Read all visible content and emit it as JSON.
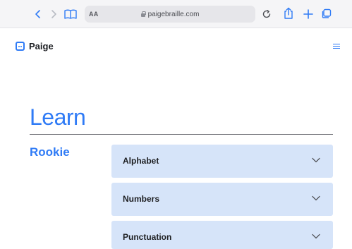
{
  "browser": {
    "text_size_label": "AA",
    "url": "paigebraille.com"
  },
  "site": {
    "logo_text": "Paige"
  },
  "main": {
    "title": "Learn",
    "level_heading": "Rookie",
    "sections": [
      {
        "label": "Alphabet"
      },
      {
        "label": "Numbers"
      },
      {
        "label": "Punctuation"
      }
    ]
  },
  "colors": {
    "accent": "#2f7bf6",
    "section_bg": "#d6e4f9"
  }
}
